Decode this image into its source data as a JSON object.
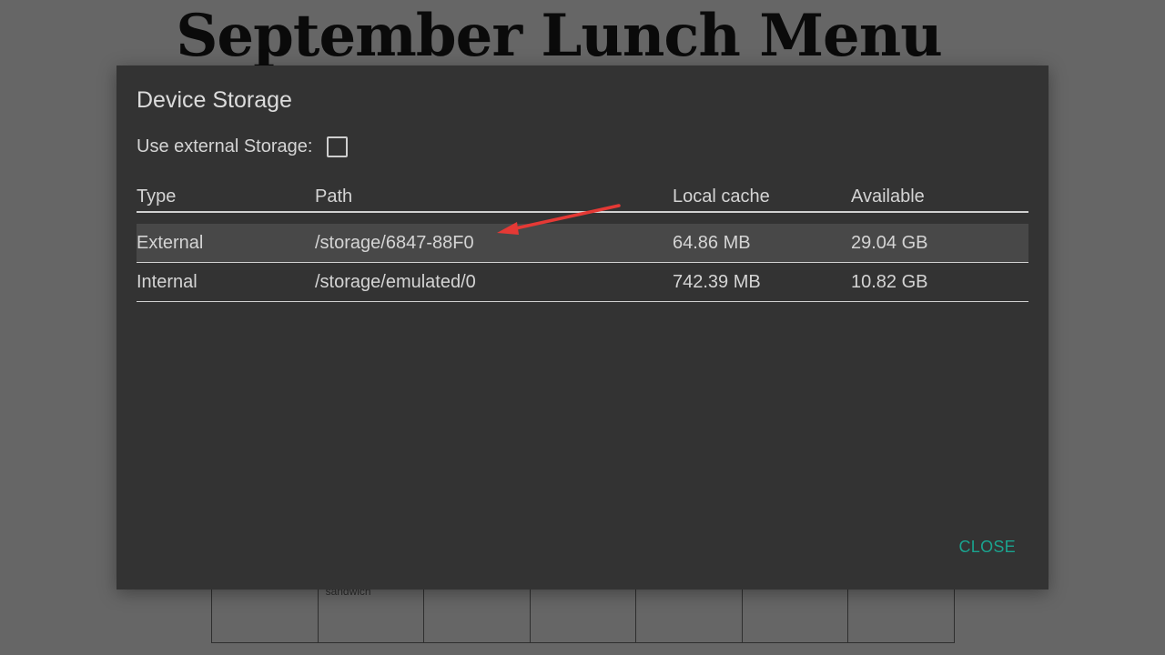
{
  "background": {
    "page_title": "September Lunch Menu",
    "grid_cells": [
      "",
      "sandwich",
      "",
      "",
      "",
      "",
      ""
    ]
  },
  "dialog": {
    "title": "Device Storage",
    "use_external_label": "Use external Storage:",
    "use_external_checked": false,
    "columns": {
      "type": "Type",
      "path": "Path",
      "local_cache": "Local cache",
      "available": "Available"
    },
    "rows": [
      {
        "type": "External",
        "path": "/storage/6847-88F0",
        "local_cache": "64.86 MB",
        "available": "29.04 GB",
        "selected": true
      },
      {
        "type": "Internal",
        "path": "/storage/emulated/0",
        "local_cache": "742.39 MB",
        "available": "10.82 GB",
        "selected": false
      }
    ],
    "close_label": "CLOSE"
  },
  "colors": {
    "backdrop": "#666666",
    "dialog_bg": "#333333",
    "selected_row": "#484848",
    "accent": "#1aa38f",
    "annotation_arrow": "#e53935"
  },
  "icons": {
    "annotation": "arrow-icon"
  }
}
